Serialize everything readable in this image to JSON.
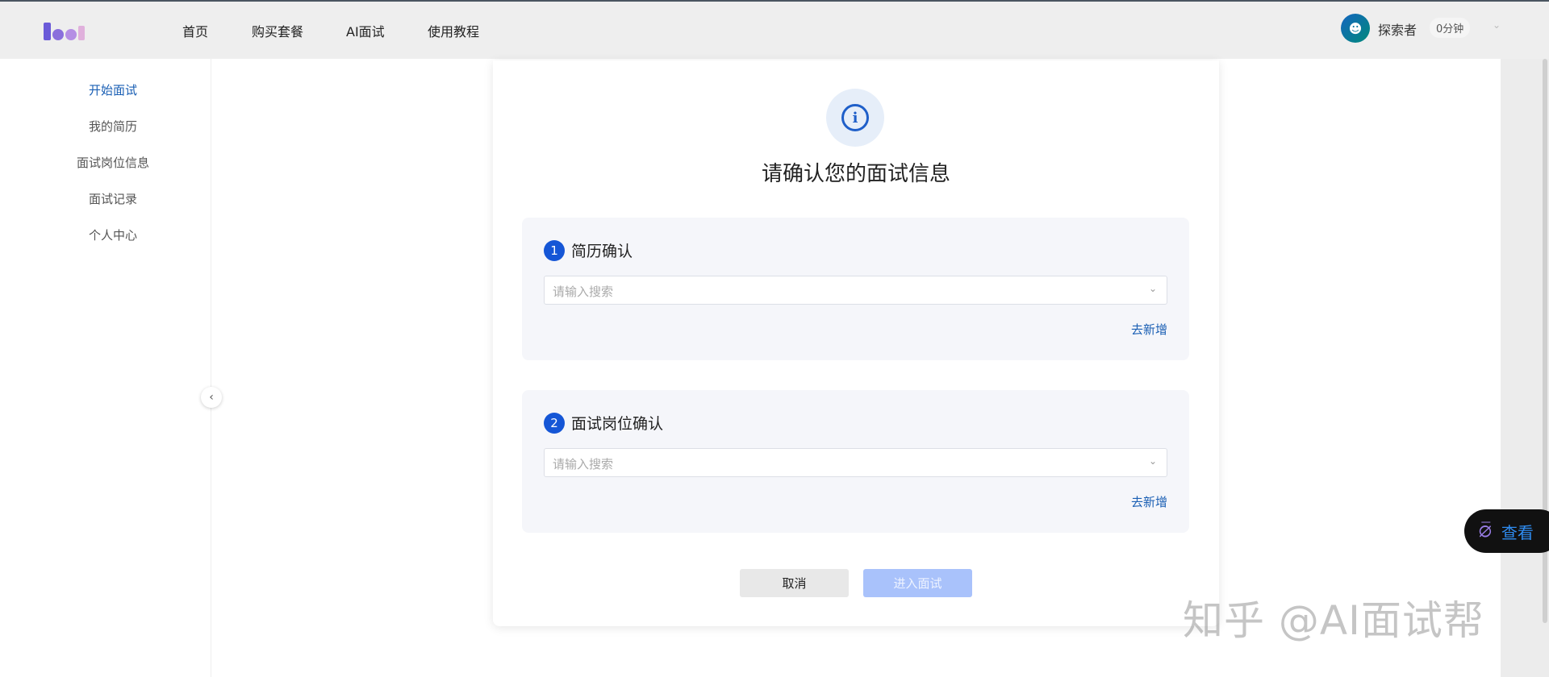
{
  "header": {
    "nav": [
      "首页",
      "购买套餐",
      "AI面试",
      "使用教程"
    ],
    "user_name": "探索者",
    "minutes_badge": "0分钟"
  },
  "sidebar": {
    "items": [
      "开始面试",
      "我的简历",
      "面试岗位信息",
      "面试记录",
      "个人中心"
    ],
    "active_index": 0
  },
  "dialog": {
    "title": "请确认您的面试信息",
    "sections": [
      {
        "number": "1",
        "title": "简历确认",
        "placeholder": "请输入搜索",
        "add_link": "去新增"
      },
      {
        "number": "2",
        "title": "面试岗位确认",
        "placeholder": "请输入搜索",
        "add_link": "去新增"
      }
    ],
    "cancel_label": "取消",
    "enter_label": "进入面试"
  },
  "floating": {
    "label": "查看"
  },
  "watermark": "知乎 @AI面试帮",
  "colors": {
    "primary": "#1556d6",
    "link": "#1a5fb4",
    "disabled_button": "#a9c2fb"
  }
}
